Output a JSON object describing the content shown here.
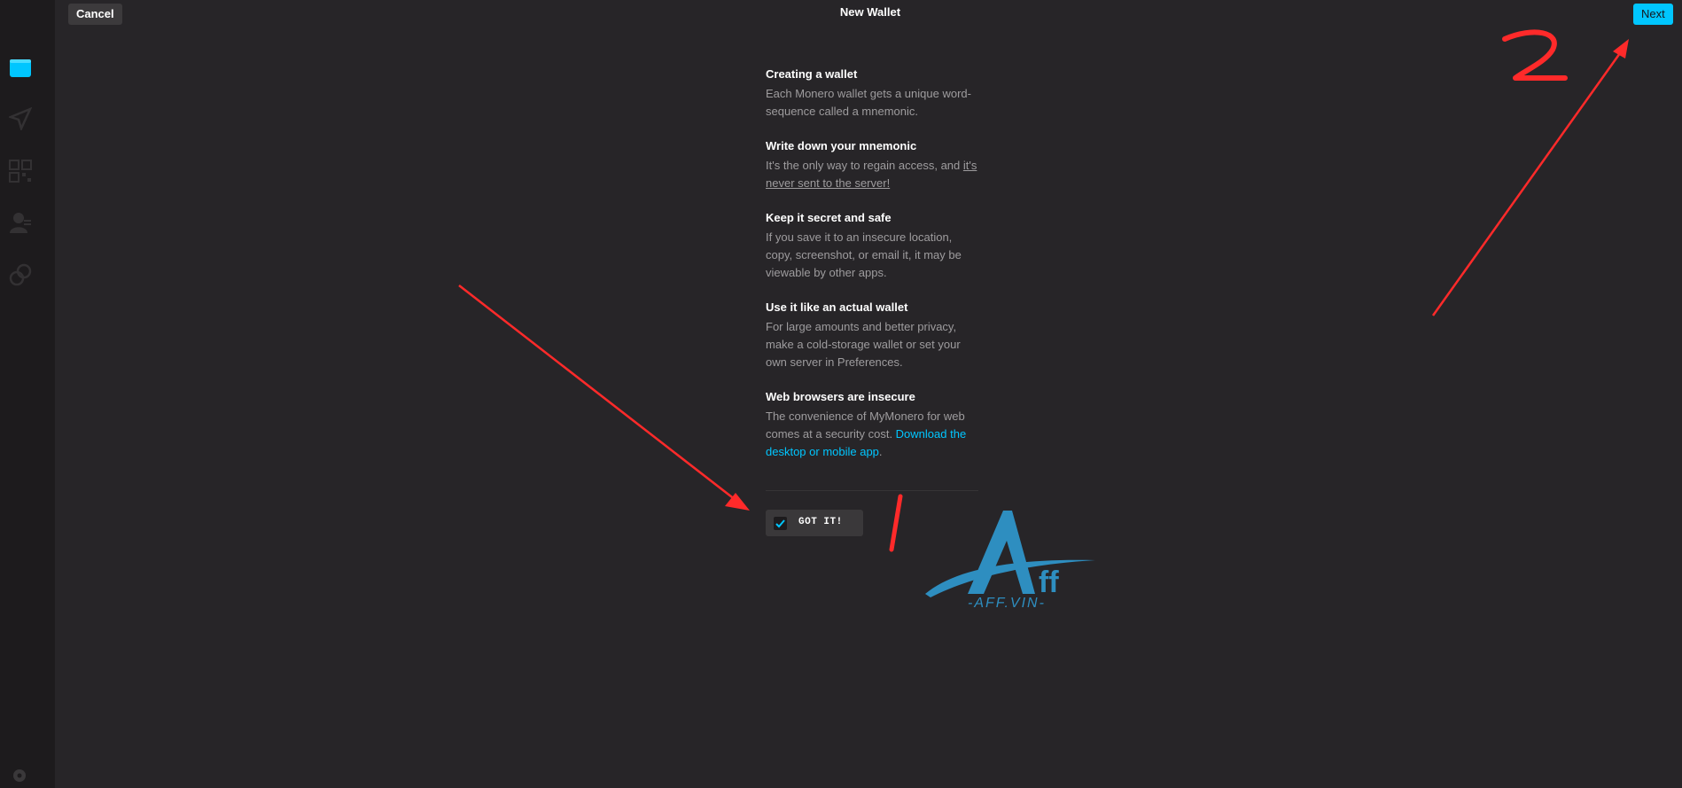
{
  "header": {
    "title": "New Wallet",
    "cancel_label": "Cancel",
    "next_label": "Next"
  },
  "sidebar": {
    "items": [
      {
        "icon": "wallets-icon",
        "active": true
      },
      {
        "icon": "send-icon",
        "active": false
      },
      {
        "icon": "request-icon",
        "active": false
      },
      {
        "icon": "contacts-icon",
        "active": false
      },
      {
        "icon": "exchange-icon",
        "active": false
      },
      {
        "icon": "settings-icon",
        "active": false
      }
    ]
  },
  "sections": [
    {
      "title": "Creating a wallet",
      "text": "Each Monero wallet gets a unique word-sequence called a mnemonic."
    },
    {
      "title": "Write down your mnemonic",
      "text_before": "It's the only way to regain access, and ",
      "text_underline": "it's never sent to the server!"
    },
    {
      "title": "Keep it secret and safe",
      "text": "If you save it to an insecure location, copy, screenshot, or email it, it may be viewable by other apps."
    },
    {
      "title": "Use it like an actual wallet",
      "text": "For large amounts and better privacy, make a cold-storage wallet or set your own server in Preferences."
    },
    {
      "title": "Web browsers are insecure",
      "text_before": "The convenience of MyMonero for web comes at a security cost. ",
      "link_text": "Download the desktop or mobile app",
      "text_after": "."
    }
  ],
  "acknowledge": {
    "label": "GOT IT!",
    "checked": true
  },
  "annotations": {
    "step1": "1",
    "step2": "2"
  },
  "watermark": {
    "text": "-AFF.VIN-"
  },
  "colors": {
    "accent": "#00c6ff",
    "background": "#272528",
    "sidebar": "#1d1b1d",
    "annotation": "#ff2a2a"
  }
}
